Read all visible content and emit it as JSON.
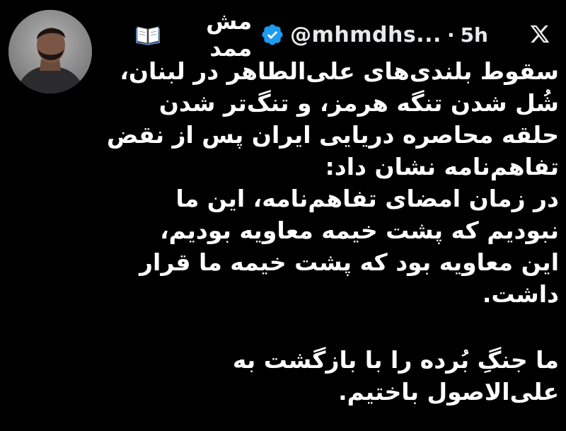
{
  "tweet": {
    "author": {
      "display_name": "مش ممد",
      "handle": "@mhmdhs...",
      "separator": "·",
      "time": "5h",
      "verified": true,
      "name_emoji_icon": "open-book-icon"
    },
    "close_icon": "x-logo-icon",
    "body": {
      "paragraph_1": "سقوط بلندی‌های علی‌الطاهر در لبنان،\nشُل شدن تنگه هرمز، و تنگ‌تر شدن\nحلقه محاصره دریایی ایران پس از نقض\nتفاهم‌نامه نشان داد:\nدر زمان امضای تفاهم‌نامه، این ما\nنبودیم که پشت خیمه معاویه بودیم،\nاین معاویه بود که پشت خیمه ما قرار\nداشت.",
      "paragraph_2": "ما جنگِ بُرده را با بازگشت به\nعلی‌الاصول باختیم."
    }
  },
  "colors": {
    "background": "#000000",
    "text": "#ffffff",
    "verified_badge": "#1d9bf0"
  }
}
